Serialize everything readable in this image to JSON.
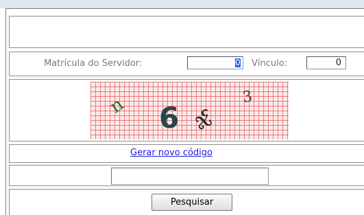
{
  "form": {
    "matricula_label": "Matrícula do Servidor:",
    "matricula_value": "0",
    "vinculo_label": "Vínculo:",
    "vinculo_value": "0",
    "captcha_chars": [
      "n",
      "6",
      "ჯ",
      "3"
    ],
    "new_code_link": "Gerar novo código",
    "code_value": "",
    "search_button": "Pesquisar"
  },
  "colors": {
    "link": "#1a1ae6",
    "captcha_grid": "#e76060",
    "cursor_highlight": "#2b62d9"
  }
}
